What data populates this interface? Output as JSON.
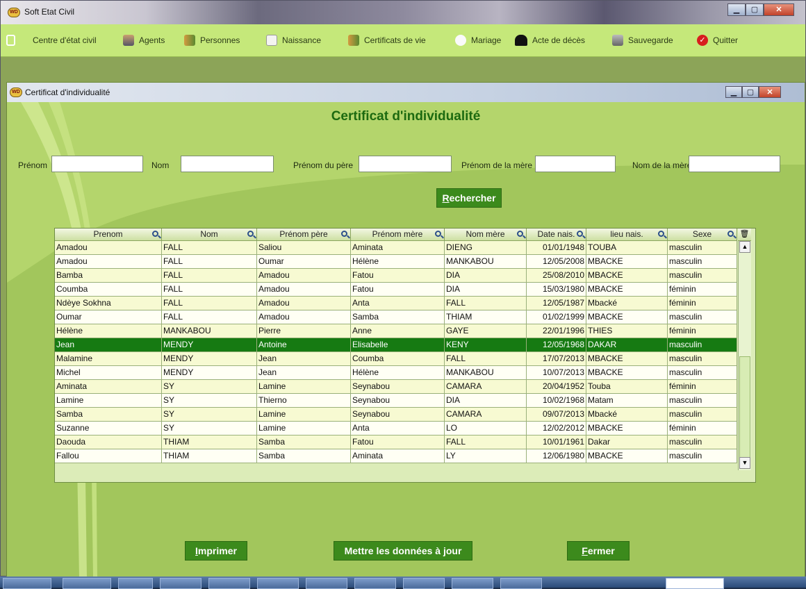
{
  "window": {
    "title": "Soft Etat Civil",
    "app_icon_text": "WD"
  },
  "menu": [
    {
      "label": "Centre d'état civil",
      "icon": "building-icon"
    },
    {
      "label": "Agents",
      "icon": "agent-icon"
    },
    {
      "label": "Personnes",
      "icon": "people-icon"
    },
    {
      "label": "Naissance",
      "icon": "document-icon"
    },
    {
      "label": "Certificats de vie",
      "icon": "people-icon"
    },
    {
      "label": "Mariage",
      "icon": "couple-icon"
    },
    {
      "label": "Acte de décès",
      "icon": "tomb-icon"
    },
    {
      "label": "Sauvegarde",
      "icon": "backup-icon"
    },
    {
      "label": "Quitter",
      "icon": "check-icon"
    }
  ],
  "child_window": {
    "title": "Certificat d'individualité"
  },
  "heading": "Certificat d'individualité",
  "search_fields": {
    "prenom": {
      "label": "Prénom",
      "value": ""
    },
    "nom": {
      "label": "Nom",
      "value": ""
    },
    "prenom_pere": {
      "label": "Prénom du père",
      "value": ""
    },
    "prenom_mere": {
      "label": "Prénom de la mère",
      "value": ""
    },
    "nom_mere": {
      "label": "Nom de la mère",
      "value": ""
    }
  },
  "buttons": {
    "search_first": "R",
    "search_rest": "echercher",
    "print_first": "I",
    "print_rest": "mprimer",
    "update": "Mettre les données à jour",
    "close_first": "F",
    "close_rest": "ermer"
  },
  "table": {
    "columns": [
      "Prenom",
      "Nom",
      "Prénom père",
      "Prénom mère",
      "Nom mère",
      "Date nais.",
      "lieu nais.",
      "Sexe"
    ],
    "selected_row": 7,
    "rows": [
      [
        "Amadou",
        "FALL",
        "Saliou",
        "Aminata",
        "DIENG",
        "01/01/1948",
        "TOUBA",
        "masculin"
      ],
      [
        "Amadou",
        "FALL",
        "Oumar",
        "Hélène",
        "MANKABOU",
        "12/05/2008",
        "MBACKE",
        "masculin"
      ],
      [
        "Bamba",
        "FALL",
        "Amadou",
        "Fatou",
        "DIA",
        "25/08/2010",
        "MBACKE",
        "masculin"
      ],
      [
        "Coumba",
        "FALL",
        "Amadou",
        "Fatou",
        "DIA",
        "15/03/1980",
        "MBACKE",
        "féminin"
      ],
      [
        "Ndèye Sokhna",
        "FALL",
        "Amadou",
        "Anta",
        "FALL",
        "12/05/1987",
        "Mbacké",
        "féminin"
      ],
      [
        "Oumar",
        "FALL",
        "Amadou",
        "Samba",
        "THIAM",
        "01/02/1999",
        "MBACKE",
        "masculin"
      ],
      [
        "Hélène",
        "MANKABOU",
        "Pierre",
        "Anne",
        "GAYE",
        "22/01/1996",
        "THIES",
        "féminin"
      ],
      [
        "Jean",
        "MENDY",
        "Antoine",
        "Elisabelle",
        "KENY",
        "12/05/1968",
        "DAKAR",
        "masculin"
      ],
      [
        "Malamine",
        "MENDY",
        "Jean",
        "Coumba",
        "FALL",
        "17/07/2013",
        "MBACKE",
        "masculin"
      ],
      [
        "Michel",
        "MENDY",
        "Jean",
        "Hélène",
        "MANKABOU",
        "10/07/2013",
        "MBACKE",
        "masculin"
      ],
      [
        "Aminata",
        "SY",
        "Lamine",
        "Seynabou",
        "CAMARA",
        "20/04/1952",
        "Touba",
        "féminin"
      ],
      [
        "Lamine",
        "SY",
        "Thierno",
        "Seynabou",
        "DIA",
        "10/02/1968",
        "Matam",
        "masculin"
      ],
      [
        "Samba",
        "SY",
        "Lamine",
        "Seynabou",
        "CAMARA",
        "09/07/2013",
        "Mbacké",
        "masculin"
      ],
      [
        "Suzanne",
        "SY",
        "Lamine",
        "Anta",
        "LO",
        "12/02/2012",
        "MBACKE",
        "féminin"
      ],
      [
        "Daouda",
        "THIAM",
        "Samba",
        "Fatou",
        "FALL",
        "10/01/1961",
        "Dakar",
        "masculin"
      ],
      [
        "Fallou",
        "THIAM",
        "Samba",
        "Aminata",
        "LY",
        "12/06/1980",
        "MBACKE",
        "masculin"
      ]
    ]
  },
  "colors": {
    "accent": "#3c8a1c",
    "selection": "#167a12",
    "title": "#1c6a10",
    "menubar": "#c5e87a"
  }
}
